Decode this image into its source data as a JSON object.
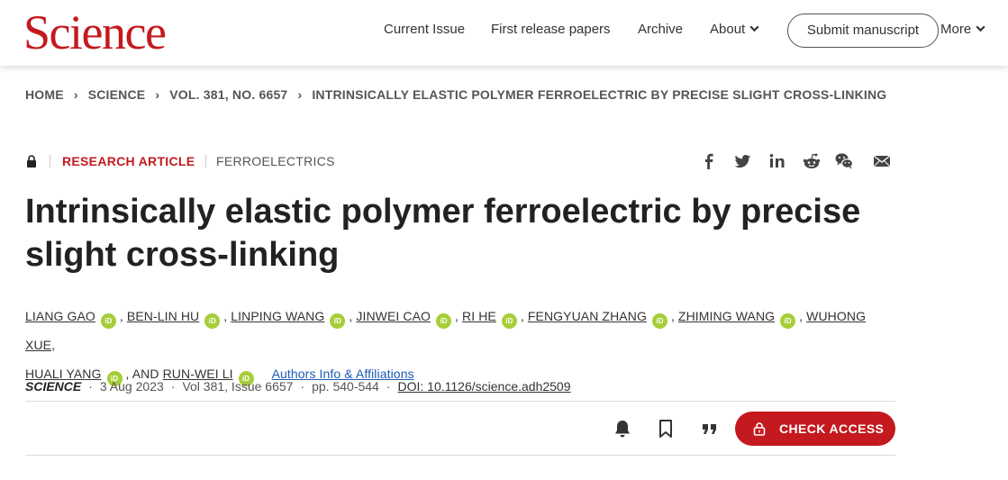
{
  "header": {
    "logo": "Science",
    "nav": [
      "Current Issue",
      "First release papers",
      "Archive",
      "About",
      "More"
    ],
    "submit": "Submit manuscript"
  },
  "breadcrumb": [
    "HOME",
    "SCIENCE",
    "VOL. 381, NO. 6657",
    "INTRINSICALLY ELASTIC POLYMER FERROELECTRIC BY PRECISE SLIGHT CROSS-LINKING"
  ],
  "article": {
    "type": "RESEARCH ARTICLE",
    "topic": "FERROELECTRICS",
    "title": "Intrinsically elastic polymer ferroelectric by precise slight cross-linking",
    "authors": [
      "LIANG GAO",
      "BEN-LIN HU",
      "LINPING WANG",
      "JINWEI CAO",
      "RI HE",
      "FENGYUAN ZHANG",
      "ZHIMING WANG",
      "WUHONG XUE",
      "HUALI YANG",
      "RUN-WEI LI"
    ],
    "and": "AND",
    "orcid": "iD",
    "affiliations": "Authors Info & Affiliations"
  },
  "citation": {
    "journal": "SCIENCE",
    "date": "3 Aug 2023",
    "volume": "Vol 381, Issue 6657",
    "pages": "pp. 540-544",
    "doi": "DOI: 10.1126/science.adh2509"
  },
  "share_icons": [
    "facebook-icon",
    "twitter-icon",
    "linkedin-icon",
    "reddit-icon",
    "wechat-icon",
    "email-icon"
  ],
  "tool_icons": [
    "bell-icon",
    "bookmark-icon",
    "quote-icon"
  ],
  "access_button": "CHECK ACCESS",
  "colors": {
    "brand": "#c4191e",
    "orcid": "#a6ce39",
    "link": "#1a5bb5"
  }
}
